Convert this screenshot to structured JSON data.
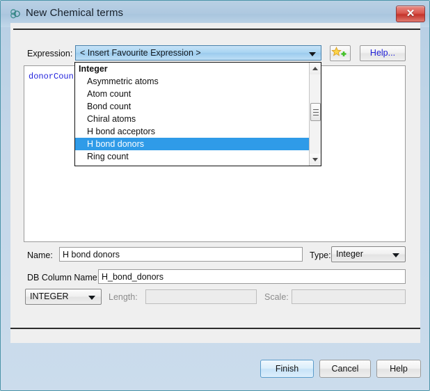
{
  "window": {
    "title": "New Chemical terms",
    "icon": "chemical-structure-icon",
    "close_label": "✕"
  },
  "expression_row": {
    "label": "Expression:",
    "combo_value": "< Insert Favourite Expression >",
    "add_favourite_icon": "star-plus-icon",
    "help_label": "Help..."
  },
  "expression_area": {
    "code": "donorCount"
  },
  "dropdown": {
    "items": [
      {
        "label": "Integer",
        "type": "group",
        "selected": false
      },
      {
        "label": "Asymmetric atoms",
        "type": "item",
        "selected": false
      },
      {
        "label": "Atom count",
        "type": "item",
        "selected": false
      },
      {
        "label": "Bond count",
        "type": "item",
        "selected": false
      },
      {
        "label": "Chiral atoms",
        "type": "item",
        "selected": false
      },
      {
        "label": "H bond acceptors",
        "type": "item",
        "selected": false
      },
      {
        "label": "H bond donors",
        "type": "item",
        "selected": true
      },
      {
        "label": "Ring count",
        "type": "item",
        "selected": false
      }
    ],
    "scroll_up_icon": "scroll-up-arrow-icon",
    "scroll_down_icon": "scroll-down-arrow-icon",
    "highlight_color": "#2f9be8"
  },
  "name_row": {
    "label": "Name:",
    "value": "H bond donors",
    "type_label": "Type:",
    "type_value": "Integer"
  },
  "db_column_row": {
    "label": "DB Column Name:",
    "value": "H_bond_donors"
  },
  "sql_type_row": {
    "sql_type_value": "INTEGER",
    "length_label": "Length:",
    "length_value": "",
    "scale_label": "Scale:",
    "scale_value": ""
  },
  "footer": {
    "finish_label": "Finish",
    "cancel_label": "Cancel",
    "help_label": "Help"
  }
}
